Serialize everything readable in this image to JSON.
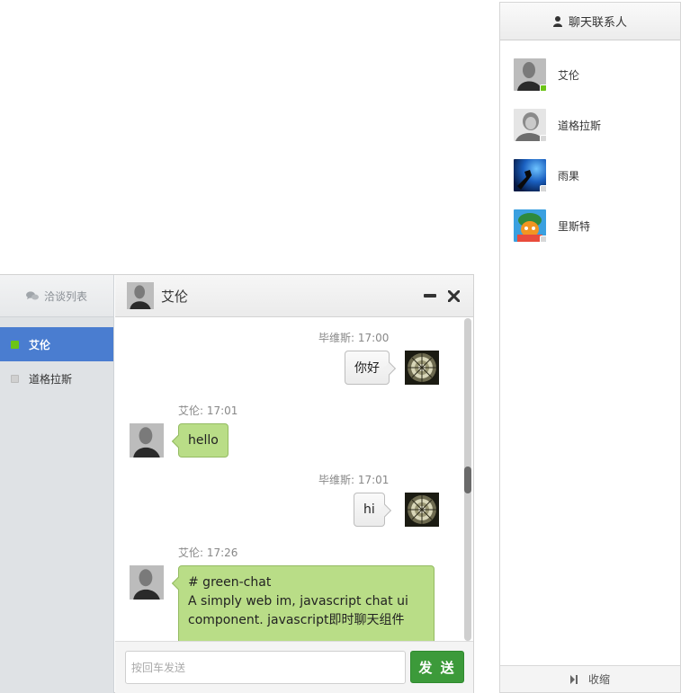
{
  "contacts": {
    "header_label": "聊天联系人",
    "footer_label": "收缩",
    "items": [
      {
        "name": "艾伦",
        "status": "online",
        "status_color": "#6cc417"
      },
      {
        "name": "道格拉斯",
        "status": "offline",
        "status_color": "#d8d8d8"
      },
      {
        "name": "雨果",
        "status": "offline",
        "status_color": "#d8d8d8"
      },
      {
        "name": "里斯特",
        "status": "offline",
        "status_color": "#d8d8d8"
      }
    ]
  },
  "chat": {
    "list_header": "洽谈列表",
    "conversations": [
      {
        "name": "艾伦",
        "active": true,
        "indicator_color": "#6cc417"
      },
      {
        "name": "道格拉斯",
        "active": false,
        "indicator_color": "#d0d0d0"
      }
    ],
    "header_title": "艾伦",
    "messages": [
      {
        "sender": "毕维斯",
        "time": "17:00",
        "meta": "毕维斯: 17:00",
        "text": "你好",
        "side": "right"
      },
      {
        "sender": "艾伦",
        "time": "17:01",
        "meta": "艾伦: 17:01",
        "text": "hello",
        "side": "left"
      },
      {
        "sender": "毕维斯",
        "time": "17:01",
        "meta": "毕维斯: 17:01",
        "text": "hi",
        "side": "right"
      },
      {
        "sender": "艾伦",
        "time": "17:26",
        "meta": "艾伦: 17:26",
        "side": "left",
        "lines": [
          "# green-chat",
          "A simply web im, javascript chat ui",
          "component. javascript即时聊天组件"
        ]
      }
    ],
    "input_placeholder": "按回车发送",
    "send_label": "发 送"
  },
  "colors": {
    "accent_blue": "#4a7dd0",
    "send_green": "#3c9a3a",
    "bubble_green": "#b9dd87"
  }
}
